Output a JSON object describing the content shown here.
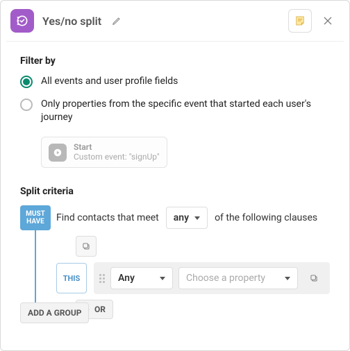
{
  "header": {
    "title": "Yes/no split"
  },
  "filter": {
    "label": "Filter by",
    "options": {
      "all": "All events and user profile fields",
      "specific": "Only properties from the specific event that started each user's journey"
    },
    "start": {
      "title": "Start",
      "subtitle": "Custom event: \"signUp\""
    }
  },
  "criteria": {
    "label": "Split criteria",
    "must_have": "MUST HAVE",
    "find_prefix": "Find contacts that meet",
    "any_label": "any",
    "find_suffix": "of the following clauses",
    "this_label": "THIS",
    "clause_any": "Any",
    "property_placeholder": "Choose a property",
    "or_label": "OR",
    "add_group": "ADD A GROUP"
  }
}
